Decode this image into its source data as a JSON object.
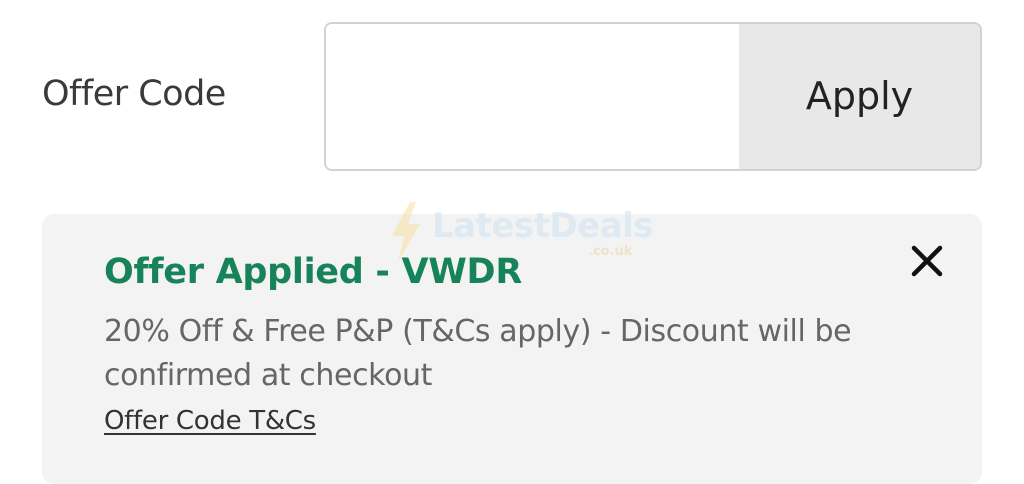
{
  "offer_code": {
    "label": "Offer Code",
    "input_value": "",
    "input_placeholder": "",
    "apply_label": "Apply"
  },
  "applied": {
    "title": "Offer Applied - VWDR",
    "description": "20% Off & Free P&P (T&Cs apply) - Discount will be confirmed at checkout",
    "terms_link": "Offer Code T&Cs",
    "close_icon": "close-icon"
  },
  "watermark": {
    "text": "LatestDeals",
    "sub": ".co.uk"
  },
  "colors": {
    "accent_green": "#16835a",
    "apply_bg": "#e8e8e8",
    "panel_bg": "#f3f3f3"
  }
}
